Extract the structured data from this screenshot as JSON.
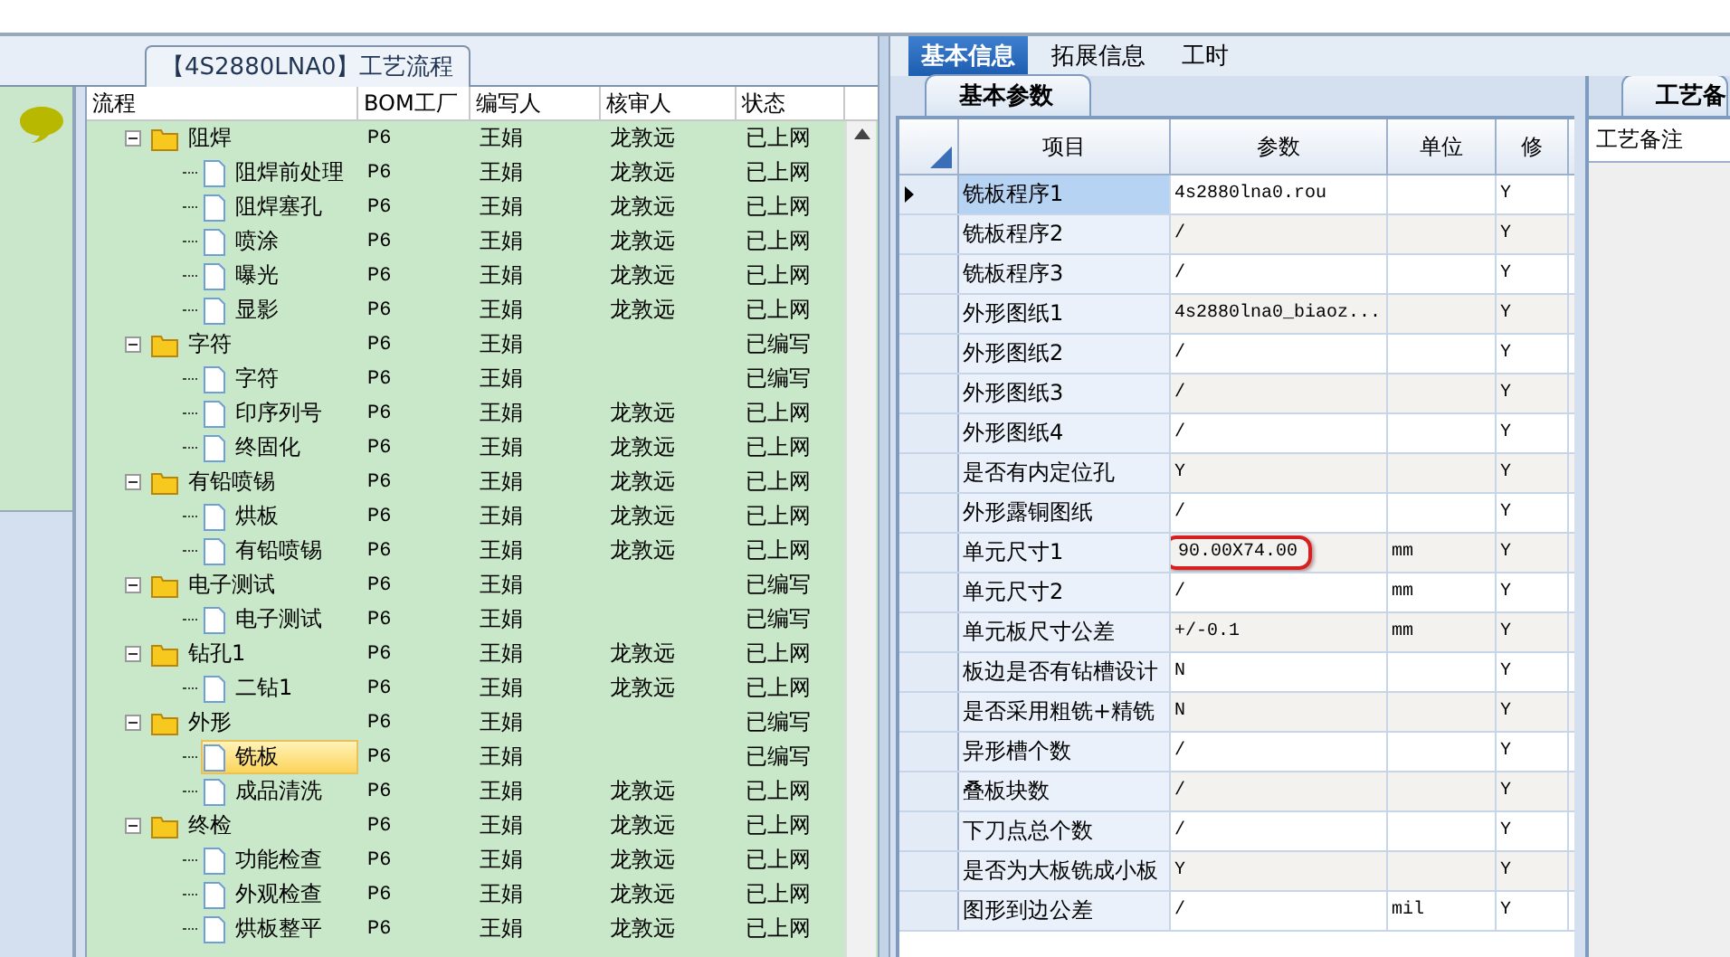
{
  "flow_panel": {
    "title": "【4S2880LNA0】工艺流程",
    "columns": [
      "流程",
      "BOM工厂",
      "编写人",
      "核审人",
      "状态"
    ],
    "tree": [
      {
        "kind": "folder",
        "name": "阻焊",
        "bom": "P6",
        "writer": "王娟",
        "reviewer": "龙敦远",
        "status": "已上网",
        "expanded": true,
        "selected": false,
        "children": [
          {
            "kind": "file",
            "name": "阻焊前处理",
            "bom": "P6",
            "writer": "王娟",
            "reviewer": "龙敦远",
            "status": "已上网",
            "selected": false
          },
          {
            "kind": "file",
            "name": "阻焊塞孔",
            "bom": "P6",
            "writer": "王娟",
            "reviewer": "龙敦远",
            "status": "已上网",
            "selected": false
          },
          {
            "kind": "file",
            "name": "喷涂",
            "bom": "P6",
            "writer": "王娟",
            "reviewer": "龙敦远",
            "status": "已上网",
            "selected": false
          },
          {
            "kind": "file",
            "name": "曝光",
            "bom": "P6",
            "writer": "王娟",
            "reviewer": "龙敦远",
            "status": "已上网",
            "selected": false
          },
          {
            "kind": "file",
            "name": "显影",
            "bom": "P6",
            "writer": "王娟",
            "reviewer": "龙敦远",
            "status": "已上网",
            "selected": false
          }
        ]
      },
      {
        "kind": "folder",
        "name": "字符",
        "bom": "P6",
        "writer": "王娟",
        "status": "已编写",
        "expanded": true,
        "selected": false,
        "children": [
          {
            "kind": "file",
            "name": "字符",
            "bom": "P6",
            "writer": "王娟",
            "status": "已编写",
            "selected": false
          },
          {
            "kind": "file",
            "name": "印序列号",
            "bom": "P6",
            "writer": "王娟",
            "reviewer": "龙敦远",
            "status": "已上网",
            "selected": false
          },
          {
            "kind": "file",
            "name": "终固化",
            "bom": "P6",
            "writer": "王娟",
            "reviewer": "龙敦远",
            "status": "已上网",
            "selected": false
          }
        ]
      },
      {
        "kind": "folder",
        "name": "有铅喷锡",
        "bom": "P6",
        "writer": "王娟",
        "reviewer": "龙敦远",
        "status": "已上网",
        "expanded": true,
        "selected": false,
        "children": [
          {
            "kind": "file",
            "name": "烘板",
            "bom": "P6",
            "writer": "王娟",
            "reviewer": "龙敦远",
            "status": "已上网",
            "selected": false
          },
          {
            "kind": "file",
            "name": "有铅喷锡",
            "bom": "P6",
            "writer": "王娟",
            "reviewer": "龙敦远",
            "status": "已上网",
            "selected": false
          }
        ]
      },
      {
        "kind": "folder",
        "name": "电子测试",
        "bom": "P6",
        "writer": "王娟",
        "status": "已编写",
        "expanded": true,
        "selected": false,
        "children": [
          {
            "kind": "file",
            "name": "电子测试",
            "bom": "P6",
            "writer": "王娟",
            "status": "已编写",
            "selected": false
          }
        ]
      },
      {
        "kind": "folder",
        "name": "钻孔1",
        "bom": "P6",
        "writer": "王娟",
        "reviewer": "龙敦远",
        "status": "已上网",
        "expanded": true,
        "selected": false,
        "children": [
          {
            "kind": "file",
            "name": "二钻1",
            "bom": "P6",
            "writer": "王娟",
            "reviewer": "龙敦远",
            "status": "已上网",
            "selected": false
          }
        ]
      },
      {
        "kind": "folder",
        "name": "外形",
        "bom": "P6",
        "writer": "王娟",
        "status": "已编写",
        "expanded": true,
        "selected": false,
        "children": [
          {
            "kind": "file",
            "name": "铣板",
            "bom": "P6",
            "writer": "王娟",
            "status": "已编写",
            "selected": true
          },
          {
            "kind": "file",
            "name": "成品清洗",
            "bom": "P6",
            "writer": "王娟",
            "reviewer": "龙敦远",
            "status": "已上网",
            "selected": false
          }
        ]
      },
      {
        "kind": "folder",
        "name": "终检",
        "bom": "P6",
        "writer": "王娟",
        "reviewer": "龙敦远",
        "status": "已上网",
        "expanded": true,
        "selected": false,
        "children": [
          {
            "kind": "file",
            "name": "功能检查",
            "bom": "P6",
            "writer": "王娟",
            "reviewer": "龙敦远",
            "status": "已上网",
            "selected": false
          },
          {
            "kind": "file",
            "name": "外观检查",
            "bom": "P6",
            "writer": "王娟",
            "reviewer": "龙敦远",
            "status": "已上网",
            "selected": false
          },
          {
            "kind": "file",
            "name": "烘板整平",
            "bom": "P6",
            "writer": "王娟",
            "reviewer": "龙敦远",
            "status": "已上网",
            "selected": false
          }
        ]
      }
    ]
  },
  "detail_panel": {
    "tabs": [
      {
        "label": "基本信息",
        "selected": true
      },
      {
        "label": "拓展信息",
        "selected": false
      },
      {
        "label": "工时",
        "selected": false
      }
    ],
    "sub_tab": "基本参数",
    "columns": [
      "项目",
      "参数",
      "单位",
      "修"
    ],
    "rows": [
      {
        "item": "铣板程序1",
        "param": "4s2880lna0.rou",
        "modify": "Y",
        "current": true,
        "circled": false
      },
      {
        "item": "铣板程序2",
        "param": "/",
        "modify": "Y",
        "current": false,
        "circled": false
      },
      {
        "item": "铣板程序3",
        "param": "/",
        "modify": "Y",
        "current": false,
        "circled": false
      },
      {
        "item": "外形图纸1",
        "param": "4s2880lna0_biaoz...",
        "modify": "Y",
        "current": false,
        "circled": false
      },
      {
        "item": "外形图纸2",
        "param": "/",
        "modify": "Y",
        "current": false,
        "circled": false
      },
      {
        "item": "外形图纸3",
        "param": "/",
        "modify": "Y",
        "current": false,
        "circled": false
      },
      {
        "item": "外形图纸4",
        "param": "/",
        "modify": "Y",
        "current": false,
        "circled": false
      },
      {
        "item": "是否有内定位孔",
        "param": "Y",
        "modify": "Y",
        "current": false,
        "circled": false
      },
      {
        "item": "外形露铜图纸",
        "param": "/",
        "modify": "Y",
        "current": false,
        "circled": false
      },
      {
        "item": "单元尺寸1",
        "param": "90.00X74.00",
        "unit": "mm",
        "modify": "Y",
        "current": false,
        "circled": true
      },
      {
        "item": "单元尺寸2",
        "param": "/",
        "unit": "mm",
        "modify": "Y",
        "current": false,
        "circled": false
      },
      {
        "item": "单元板尺寸公差",
        "param": "+/-0.1",
        "unit": "mm",
        "modify": "Y",
        "current": false,
        "circled": false
      },
      {
        "item": "板边是否有钻槽设计",
        "param": "N",
        "modify": "Y",
        "current": false,
        "circled": false
      },
      {
        "item": "是否采用粗铣+精铣",
        "param": "N",
        "modify": "Y",
        "current": false,
        "circled": false
      },
      {
        "item": "异形槽个数",
        "param": "/",
        "modify": "Y",
        "current": false,
        "circled": false
      },
      {
        "item": "叠板块数",
        "param": "/",
        "modify": "Y",
        "current": false,
        "circled": false
      },
      {
        "item": "下刀点总个数",
        "param": "/",
        "modify": "Y",
        "current": false,
        "circled": false
      },
      {
        "item": "是否为大板铣成小板",
        "param": "Y",
        "modify": "Y",
        "current": false,
        "circled": false
      },
      {
        "item": "图形到边公差",
        "param": "/",
        "unit": "mil",
        "modify": "Y",
        "current": false,
        "circled": false
      }
    ]
  },
  "notes_panel": {
    "tab": "工艺备",
    "header": "工艺备注"
  }
}
